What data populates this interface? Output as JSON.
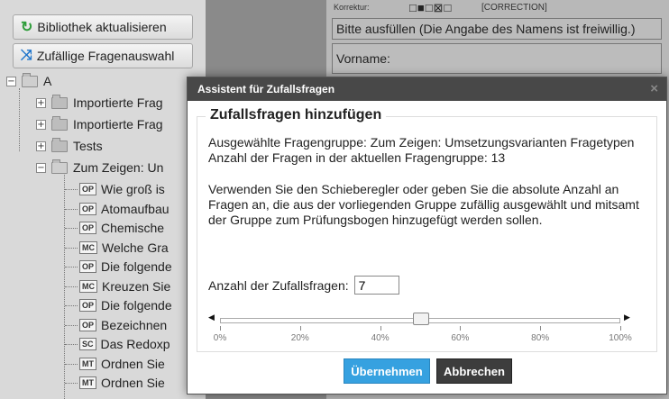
{
  "toolbar": {
    "refresh_label": "Bibliothek aktualisieren",
    "random_label": "Zufällige Fragenauswahl"
  },
  "tree": {
    "root_label": "A",
    "folders": [
      {
        "label": "Importierte Frag"
      },
      {
        "label": "Importierte Frag"
      },
      {
        "label": "Tests"
      },
      {
        "label": "Zum Zeigen: Un"
      }
    ],
    "questions": [
      {
        "type": "OP",
        "label": "Wie groß is"
      },
      {
        "type": "OP",
        "label": "Atomaufbau"
      },
      {
        "type": "OP",
        "label": "Chemische"
      },
      {
        "type": "MC",
        "label": "Welche Gra"
      },
      {
        "type": "OP",
        "label": "Die folgende"
      },
      {
        "type": "MC",
        "label": "Kreuzen Sie"
      },
      {
        "type": "OP",
        "label": "Die folgende"
      },
      {
        "type": "OP",
        "label": "Bezeichnen"
      },
      {
        "type": "SC",
        "label": "Das Redoxp"
      },
      {
        "type": "MT",
        "label": "Ordnen Sie"
      },
      {
        "type": "MT",
        "label": "Ordnen Sie"
      }
    ]
  },
  "form": {
    "korrektur_label": "Korrektur:",
    "boxes": "□■□⊠□",
    "correction_label": "[CORRECTION]",
    "hint": "Bitte ausfüllen (Die Angabe des Namens ist freiwillig.)",
    "vorname_label": "Vorname:"
  },
  "modal": {
    "title": "Assistent für Zufallsfragen",
    "close": "×",
    "legend": "Zufallsfragen hinzufügen",
    "group_line": "Ausgewählte Fragengruppe: Zum Zeigen: Umsetzungsvarianten Fragetypen",
    "count_line": "Anzahl der Fragen in der aktuellen Fragengruppe: 13",
    "instructions": "Verwenden Sie den Schieberegler oder geben Sie die absolute Anzahl an Fragen an, die aus der vorliegenden Gruppe zufällig ausgewählt und mitsamt der Gruppe zum Prüfungsbogen hinzugefügt werden sollen.",
    "count_label": "Anzahl der Zufallsfragen:",
    "count_value": "7",
    "slider": {
      "value_fraction": 0.5,
      "ticks": [
        "0%",
        "20%",
        "40%",
        "60%",
        "80%",
        "100%"
      ],
      "left_arrow": "◀",
      "right_arrow": "▶"
    },
    "apply_label": "Übernehmen",
    "cancel_label": "Abbrechen"
  },
  "colors": {
    "apply_button": "#36a1e0",
    "cancel_button": "#3d3d3d",
    "title_bar": "#484848",
    "refresh_icon": "#2e9d3a",
    "random_icon": "#2277cc"
  }
}
